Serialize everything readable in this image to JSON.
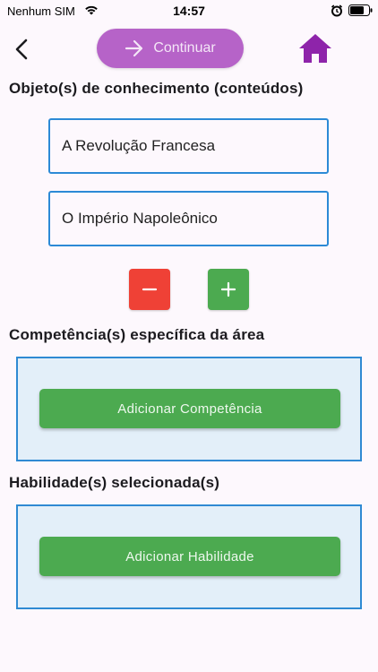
{
  "status_bar": {
    "carrier": "Nenhum SIM",
    "time": "14:57"
  },
  "header": {
    "continue_label": "Continuar",
    "accent_color": "#b663c8",
    "home_icon_color": "#8e24aa"
  },
  "objects_section": {
    "heading": "Objeto(s) de conhecimento (conteúdos)",
    "fields": [
      {
        "value": "A Revolução Francesa"
      },
      {
        "value": "O Império Napoleônico"
      }
    ],
    "remove_button_color": "#ef4136",
    "add_button_color": "#4caa50"
  },
  "competence_section": {
    "heading": "Competência(s) específica da área",
    "button_label": "Adicionar Competência"
  },
  "skills_section": {
    "heading": "Habilidade(s) selecionada(s)",
    "button_label": "Adicionar Habilidade"
  }
}
